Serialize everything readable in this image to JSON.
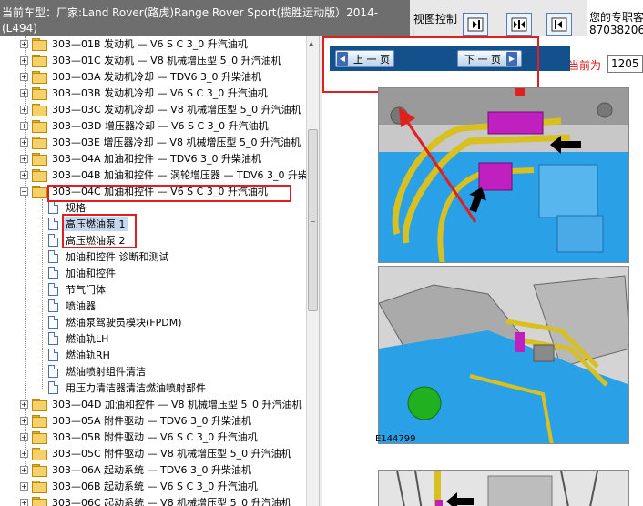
{
  "header": {
    "title_line1": "当前车型：厂家:Land Rover(路虎)Range Rover Sport(揽胜运动版）2014-",
    "title_line2": "(L494)",
    "view_control_label": "视图控制",
    "consultant_line1": "您的专职客",
    "consultant_line2": "87038206"
  },
  "tree": {
    "items": [
      {
        "label": "303—01B 发动机 — V6 S C 3_0 升汽油机",
        "type": "folder"
      },
      {
        "label": "303—01C 发动机 — V8 机械增压型 5_0 升汽油机",
        "type": "folder"
      },
      {
        "label": "303—03A 发动机冷却 — TDV6 3_0 升柴油机",
        "type": "folder"
      },
      {
        "label": "303—03B 发动机冷却 — V6 S C 3_0 升汽油机",
        "type": "folder"
      },
      {
        "label": "303—03C 发动机冷却 — V8 机械增压型 5_0 升汽油机",
        "type": "folder"
      },
      {
        "label": "303—03D 增压器冷却 — V6 S C 3_0 升汽油机",
        "type": "folder"
      },
      {
        "label": "303—03E 增压器冷却 — V8 机械增压型 5_0 升汽油机",
        "type": "folder"
      },
      {
        "label": "303—04A 加油和控件 — TDV6 3_0 升柴油机",
        "type": "folder"
      },
      {
        "label": "303—04B 加油和控件 — 涡轮增压器 — TDV6 3_0 升柴",
        "type": "folder"
      },
      {
        "label": "303—04C 加油和控件 — V6 S C 3_0 升汽油机",
        "type": "folder-open"
      },
      {
        "label": "规格",
        "type": "doc"
      },
      {
        "label": "高压燃油泵 1",
        "type": "doc"
      },
      {
        "label": "高压燃油泵 2",
        "type": "doc"
      },
      {
        "label": "加油和控件 诊断和测试",
        "type": "doc"
      },
      {
        "label": "加油和控件",
        "type": "doc"
      },
      {
        "label": "节气门体",
        "type": "doc"
      },
      {
        "label": "喷油器",
        "type": "doc"
      },
      {
        "label": "燃油泵驾驶员模块(FPDM)",
        "type": "doc"
      },
      {
        "label": "燃油轨LH",
        "type": "doc"
      },
      {
        "label": "燃油轨RH",
        "type": "doc"
      },
      {
        "label": "燃油喷射组件清洁",
        "type": "doc"
      },
      {
        "label": "用压力清洁器清洁燃油喷射部件",
        "type": "doc"
      },
      {
        "label": "303—04D 加油和控件 — V8 机械增压型 5_0 升汽油机",
        "type": "folder"
      },
      {
        "label": "303—05A 附件驱动 — TDV6 3_0 升柴油机",
        "type": "folder"
      },
      {
        "label": "303—05B 附件驱动 — V6 S C 3_0 升汽油机",
        "type": "folder"
      },
      {
        "label": "303—05C 附件驱动 — V8 机械增压型 5_0 升汽油机",
        "type": "folder"
      },
      {
        "label": "303—06A 起动系统 — TDV6 3_0 升柴油机",
        "type": "folder"
      },
      {
        "label": "303—06B 起动系统 — V6 S C 3_0 升汽油机",
        "type": "folder"
      },
      {
        "label": "303—06C 起动系统 — V8 机械增压型 5_0 升汽油机",
        "type": "folder"
      }
    ]
  },
  "nav": {
    "prev_label": "上 一 页",
    "next_label": "下 一 页",
    "current_label": "当前为",
    "page_value": "1205"
  },
  "figure": {
    "label": "E144799"
  },
  "colors": {
    "title_bar": "#6e6e6e",
    "nav_bar": "#14508c",
    "highlight_box": "#e02020",
    "engine_blue": "#2aa0e6",
    "fuel_pipe": "#d8c020",
    "pump_magenta": "#c020c0"
  }
}
